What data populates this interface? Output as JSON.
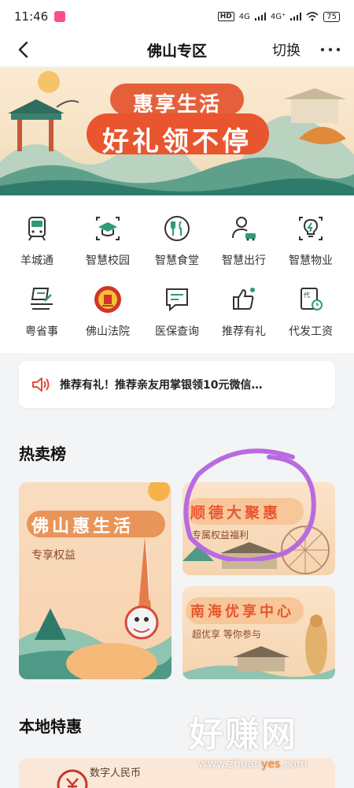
{
  "status": {
    "time": "11:46",
    "hd": "HD",
    "net1": "4G",
    "net2": "4G⁺",
    "battery": "75"
  },
  "nav": {
    "title": "佛山专区",
    "switch_label": "切换"
  },
  "banner": {
    "line1": "惠享生活",
    "line2": "好礼领不停"
  },
  "grid": [
    {
      "label": "羊城通",
      "icon": "metro-train-icon"
    },
    {
      "label": "智慧校园",
      "icon": "graduation-cap-icon"
    },
    {
      "label": "智慧食堂",
      "icon": "fork-knife-icon"
    },
    {
      "label": "智慧出行",
      "icon": "person-car-icon"
    },
    {
      "label": "智慧物业",
      "icon": "lightbulb-icon"
    },
    {
      "label": "粤省事",
      "icon": "document-pen-icon"
    },
    {
      "label": "佛山法院",
      "icon": "court-emblem-icon"
    },
    {
      "label": "医保查询",
      "icon": "chat-document-icon"
    },
    {
      "label": "推荐有礼",
      "icon": "thumbs-up-icon"
    },
    {
      "label": "代发工资",
      "icon": "salary-document-icon"
    }
  ],
  "notice": {
    "text": "推荐有礼！推荐亲友用掌银领10元微信…"
  },
  "hot": {
    "title": "热卖榜",
    "card1": {
      "title": "佛山惠生活",
      "subtitle": "专享权益"
    },
    "card2": {
      "title": "顺德大聚惠",
      "subtitle": "专属权益福利"
    },
    "card3": {
      "title": "南海优享中心",
      "subtitle": "超优享 等你参与"
    }
  },
  "local": {
    "title": "本地特惠",
    "card_text": "数字人民币"
  },
  "watermark": {
    "big": "好赚网",
    "url_a": "www.zhuan",
    "url_b": "yes",
    "url_c": ".com"
  },
  "colors": {
    "accent_green": "#2e9a7a",
    "banner_red": "#e9552e",
    "circle_purple": "#b86be0"
  }
}
